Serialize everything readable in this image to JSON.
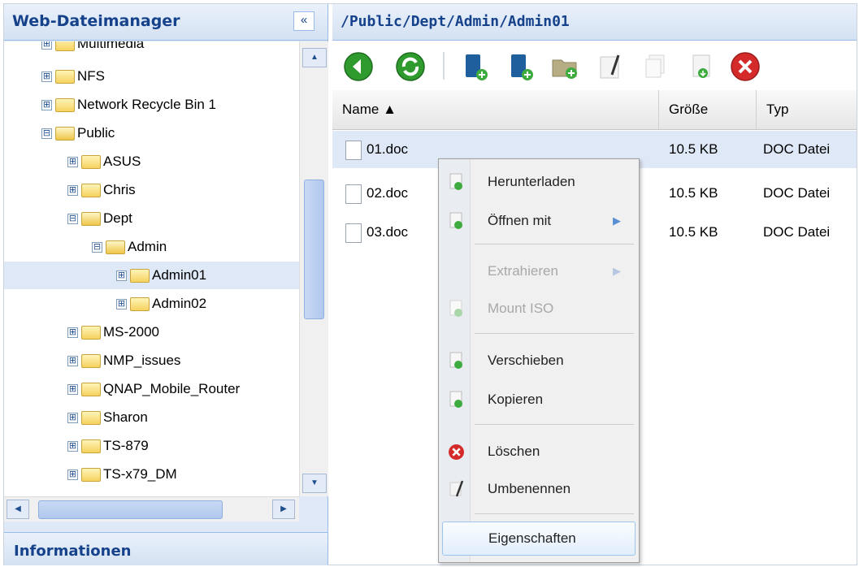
{
  "left_panel": {
    "title": "Web-Dateimanager",
    "collapse_glyph": "«",
    "info_title": "Informationen",
    "tree": [
      {
        "label": "Multimedia",
        "pm": "⊞",
        "open": false
      },
      {
        "label": "NFS",
        "pm": "⊞",
        "open": false
      },
      {
        "label": "Network Recycle Bin 1",
        "pm": "⊞",
        "open": false
      },
      {
        "label": "Public",
        "pm": "⊟",
        "open": true
      },
      {
        "label": "ASUS",
        "pm": "⊞",
        "open": false
      },
      {
        "label": "Chris",
        "pm": "⊞",
        "open": false
      },
      {
        "label": "Dept",
        "pm": "⊟",
        "open": true
      },
      {
        "label": "Admin",
        "pm": "⊟",
        "open": true
      },
      {
        "label": "Admin01",
        "pm": "⊞",
        "open": false,
        "selected": true
      },
      {
        "label": "Admin02",
        "pm": "⊞",
        "open": false
      },
      {
        "label": "MS-2000",
        "pm": "⊞",
        "open": false
      },
      {
        "label": "NMP_issues",
        "pm": "⊞",
        "open": false
      },
      {
        "label": "QNAP_Mobile_Router",
        "pm": "⊞",
        "open": false
      },
      {
        "label": "Sharon",
        "pm": "⊞",
        "open": false
      },
      {
        "label": "TS-879",
        "pm": "⊞",
        "open": false
      },
      {
        "label": "TS-x79_DM",
        "pm": "⊞",
        "open": false
      }
    ],
    "scroll_up_glyph": "▲",
    "scroll_down_glyph": "▼",
    "scroll_left_glyph": "◀",
    "scroll_right_glyph": "▶"
  },
  "main": {
    "path": "/Public/Dept/Admin/Admin01",
    "toolbar_icons": [
      "back-icon",
      "refresh-icon",
      "new-share-icon",
      "new-folder-icon",
      "upload-icon",
      "rename-icon",
      "copy-icon",
      "download-icon",
      "delete-icon"
    ],
    "columns": {
      "name": "Name ▲",
      "size": "Größe",
      "type": "Typ"
    },
    "files": [
      {
        "name": "01.doc",
        "size": "10.5 KB",
        "type": "DOC Datei"
      },
      {
        "name": "02.doc",
        "size": "10.5 KB",
        "type": "DOC Datei"
      },
      {
        "name": "03.doc",
        "size": "10.5 KB",
        "type": "DOC Datei"
      }
    ]
  },
  "context_menu": {
    "items": [
      {
        "label": "Herunterladen",
        "icon": "download-icon",
        "enabled": true,
        "submenu": false
      },
      {
        "label": "Öffnen mit",
        "icon": "open-with-icon",
        "enabled": true,
        "submenu": true
      },
      {
        "label": "Extrahieren",
        "icon": "",
        "enabled": false,
        "submenu": true
      },
      {
        "label": "Mount ISO",
        "icon": "mount-iso-icon",
        "enabled": false,
        "submenu": false
      },
      {
        "label": "Verschieben",
        "icon": "move-icon",
        "enabled": true,
        "submenu": false
      },
      {
        "label": "Kopieren",
        "icon": "copy-icon",
        "enabled": true,
        "submenu": false
      },
      {
        "label": "Löschen",
        "icon": "delete-icon",
        "enabled": true,
        "submenu": false
      },
      {
        "label": "Umbenennen",
        "icon": "rename-icon",
        "enabled": true,
        "submenu": false
      },
      {
        "label": "Eigenschaften",
        "icon": "",
        "enabled": true,
        "submenu": false
      }
    ],
    "submenu_glyph": "▶"
  },
  "colors": {
    "header_text": "#15428b",
    "selection": "#dfe8f6",
    "accent_green": "#2f9b2f",
    "delete_red": "#d42a2a"
  }
}
